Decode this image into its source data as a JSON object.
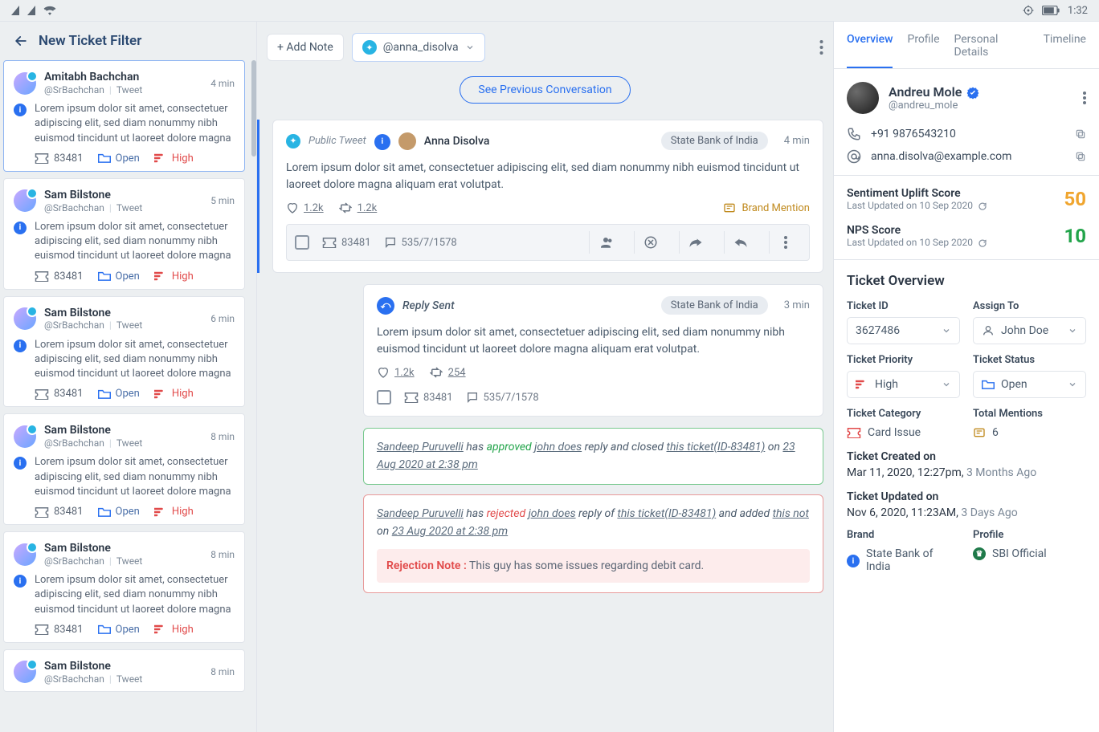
{
  "statusbar": {
    "time": "1:32"
  },
  "left": {
    "title": "New Ticket Filter",
    "items": [
      {
        "name": "Amitabh Bachchan",
        "handle": "@SrBachchan",
        "source": "Tweet",
        "time": "4 min",
        "body": "Lorem ipsum dolor sit amet, consectetuer adipiscing elit, sed diam nonummy nibh euismod tincidunt ut laoreet dolore magna",
        "ticket": "83481",
        "status": "Open",
        "priority": "High",
        "selected": true
      },
      {
        "name": "Sam Bilstone",
        "handle": "@SrBachchan",
        "source": "Tweet",
        "time": "5 min",
        "body": "Lorem ipsum dolor sit amet, consectetuer adipiscing elit, sed diam nonummy nibh euismod tincidunt ut laoreet dolore magna",
        "ticket": "83481",
        "status": "Open",
        "priority": "High",
        "selected": false
      },
      {
        "name": "Sam Bilstone",
        "handle": "@SrBachchan",
        "source": "Tweet",
        "time": "6 min",
        "body": "Lorem ipsum dolor sit amet, consectetuer adipiscing elit, sed diam nonummy nibh euismod tincidunt ut laoreet dolore magna",
        "ticket": "83481",
        "status": "Open",
        "priority": "High",
        "selected": false
      },
      {
        "name": "Sam Bilstone",
        "handle": "@SrBachchan",
        "source": "Tweet",
        "time": "8 min",
        "body": "Lorem ipsum dolor sit amet, consectetuer adipiscing elit, sed diam nonummy nibh euismod tincidunt ut laoreet dolore magna",
        "ticket": "83481",
        "status": "Open",
        "priority": "High",
        "selected": false
      },
      {
        "name": "Sam Bilstone",
        "handle": "@SrBachchan",
        "source": "Tweet",
        "time": "8 min",
        "body": "Lorem ipsum dolor sit amet, consectetuer adipiscing elit, sed diam nonummy nibh euismod tincidunt ut laoreet dolore magna",
        "ticket": "83481",
        "status": "Open",
        "priority": "High",
        "selected": false
      },
      {
        "name": "Sam Bilstone",
        "handle": "@SrBachchan",
        "source": "Tweet",
        "time": "8 min",
        "body": "",
        "ticket": "",
        "status": "",
        "priority": "",
        "selected": false
      }
    ]
  },
  "middle": {
    "add_note": "+ Add Note",
    "handle": "@anna_disolva",
    "prev_conv": "See Previous Conversation",
    "tweet": {
      "type": "Public Tweet",
      "author": "Anna Disolva",
      "org": "State Bank of India",
      "time": "4 min",
      "body": "Lorem ipsum dolor sit amet, consectetuer adipiscing elit, sed diam nonummy nibh euismod tincidunt ut laoreet dolore magna aliquam erat volutpat.",
      "likes": "1.2k",
      "rts": "1.2k",
      "mention": "Brand Mention",
      "ticket": "83481",
      "convo": "535/7/1578"
    },
    "reply": {
      "label": "Reply Sent",
      "org": "State Bank of India",
      "time": "3 min",
      "body": "Lorem ipsum dolor sit amet, consectetuer adipiscing elit, sed diam nonummy nibh euismod tincidunt ut laoreet dolore magna aliquam erat volutpat.",
      "likes": "1.2k",
      "rts": "254",
      "ticket": "83481",
      "convo": "535/7/1578"
    },
    "audit_approved": {
      "actor": "Sandeep Puruvelli",
      "verb_pre": " has ",
      "verb": "approved",
      "target": "john does",
      "mid": " reply and closed ",
      "ticket": "this ticket(ID-83481)",
      "on": " on ",
      "date": "23 Aug 2020 at 2:38 pm"
    },
    "audit_rejected": {
      "actor": "Sandeep Puruvelli",
      "verb_pre": " has ",
      "verb": "rejected",
      "target": "john does",
      "mid": " reply of ",
      "ticket": "this ticket(ID-83481)",
      "and": " and added ",
      "note_link": "this not",
      "on": " on ",
      "date": "23 Aug 2020 at 2:38 pm",
      "rej_label": "Rejection Note :",
      "rej_text": " This guy has some issues regarding debit card."
    }
  },
  "right": {
    "tabs": [
      "Overview",
      "Profile",
      "Personal Details",
      "Timeline"
    ],
    "profile": {
      "name": "Andreu Mole",
      "handle": "@andreu_mole",
      "phone": "+91 9876543210",
      "email": "anna.disolva@example.com"
    },
    "scores": {
      "sent_title": "Sentiment Uplift Score",
      "sent_sub": "Last Updated on 10 Sep 2020",
      "sent_val": "50",
      "nps_title": "NPS Score",
      "nps_sub": "Last Updated on 10 Sep 2020",
      "nps_val": "10"
    },
    "overview": {
      "title": "Ticket Overview",
      "ticket_id_label": "Ticket ID",
      "ticket_id": "3627486",
      "assign_label": "Assign To",
      "assign": "John Doe",
      "priority_label": "Ticket Priority",
      "priority": "High",
      "status_label": "Ticket Status",
      "status": "Open",
      "category_label": "Ticket Category",
      "category": "Card Issue",
      "mentions_label": "Total Mentions",
      "mentions": "6",
      "created_label": "Ticket Created on",
      "created_val": "Mar 11, 2020, 12:27pm,",
      "created_ago": " 3 Months Ago",
      "updated_label": "Ticket Updated on",
      "updated_val": "Nov 6, 2020, 11:23AM,",
      "updated_ago": " 3 Days Ago",
      "brand_label": "Brand",
      "brand": "State Bank of India",
      "profile_label": "Profile",
      "profile": "SBI Official"
    }
  }
}
